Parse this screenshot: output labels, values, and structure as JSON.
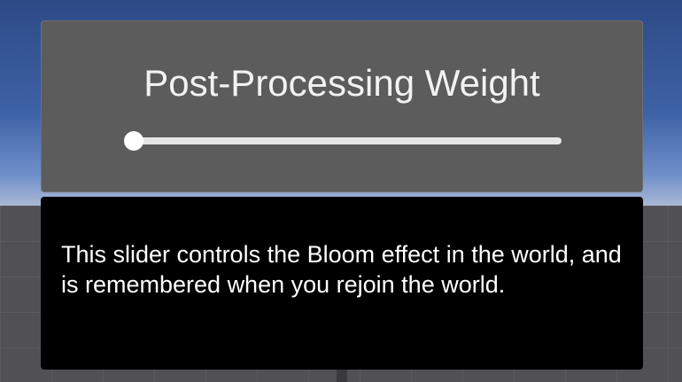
{
  "panel": {
    "title": "Post-Processing Weight"
  },
  "slider": {
    "value": 0.0,
    "min": 0.0,
    "max": 1.0
  },
  "info": {
    "description": "This slider controls the Bloom effect in the world, and is remembered when you rejoin the world."
  },
  "colors": {
    "sky": "#3e62a6",
    "panel": "#5c5c5c",
    "info_panel": "#000000",
    "track": "#e6e6e6",
    "text": "#ffffff"
  }
}
